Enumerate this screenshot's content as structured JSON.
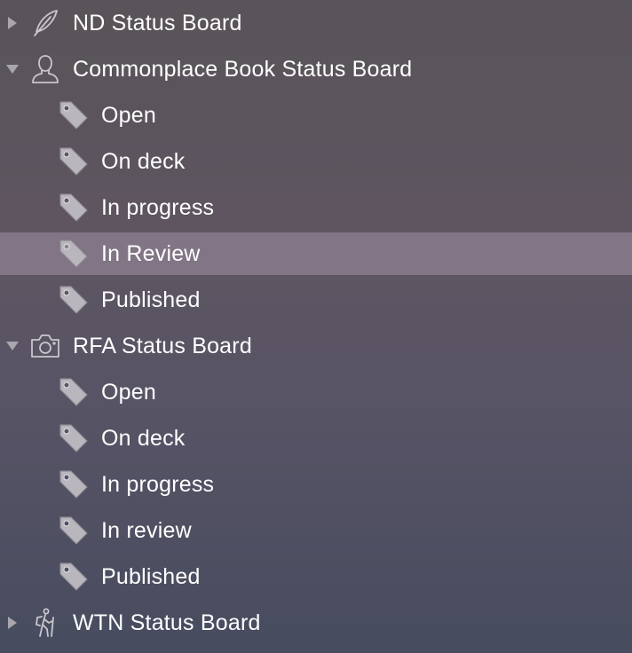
{
  "sidebar": {
    "boards": [
      {
        "label": "ND Status Board",
        "icon": "quill-pen-icon",
        "expanded": false,
        "columns": []
      },
      {
        "label": "Commonplace Book Status Board",
        "icon": "person-icon",
        "expanded": true,
        "columns": [
          {
            "label": "Open"
          },
          {
            "label": "On deck"
          },
          {
            "label": "In progress"
          },
          {
            "label": "In Review",
            "selected": true
          },
          {
            "label": "Published"
          }
        ]
      },
      {
        "label": "RFA Status Board",
        "icon": "camera-icon",
        "expanded": true,
        "columns": [
          {
            "label": "Open"
          },
          {
            "label": "On deck"
          },
          {
            "label": "In progress"
          },
          {
            "label": "In review"
          },
          {
            "label": "Published"
          }
        ]
      },
      {
        "label": "WTN Status Board",
        "icon": "hiker-icon",
        "expanded": false,
        "columns": []
      }
    ]
  },
  "colors": {
    "selection": "#8f8494",
    "icon_outline": "#c9c6cc",
    "tag_fill": "#b9b6bd",
    "text": "#ffffff"
  }
}
